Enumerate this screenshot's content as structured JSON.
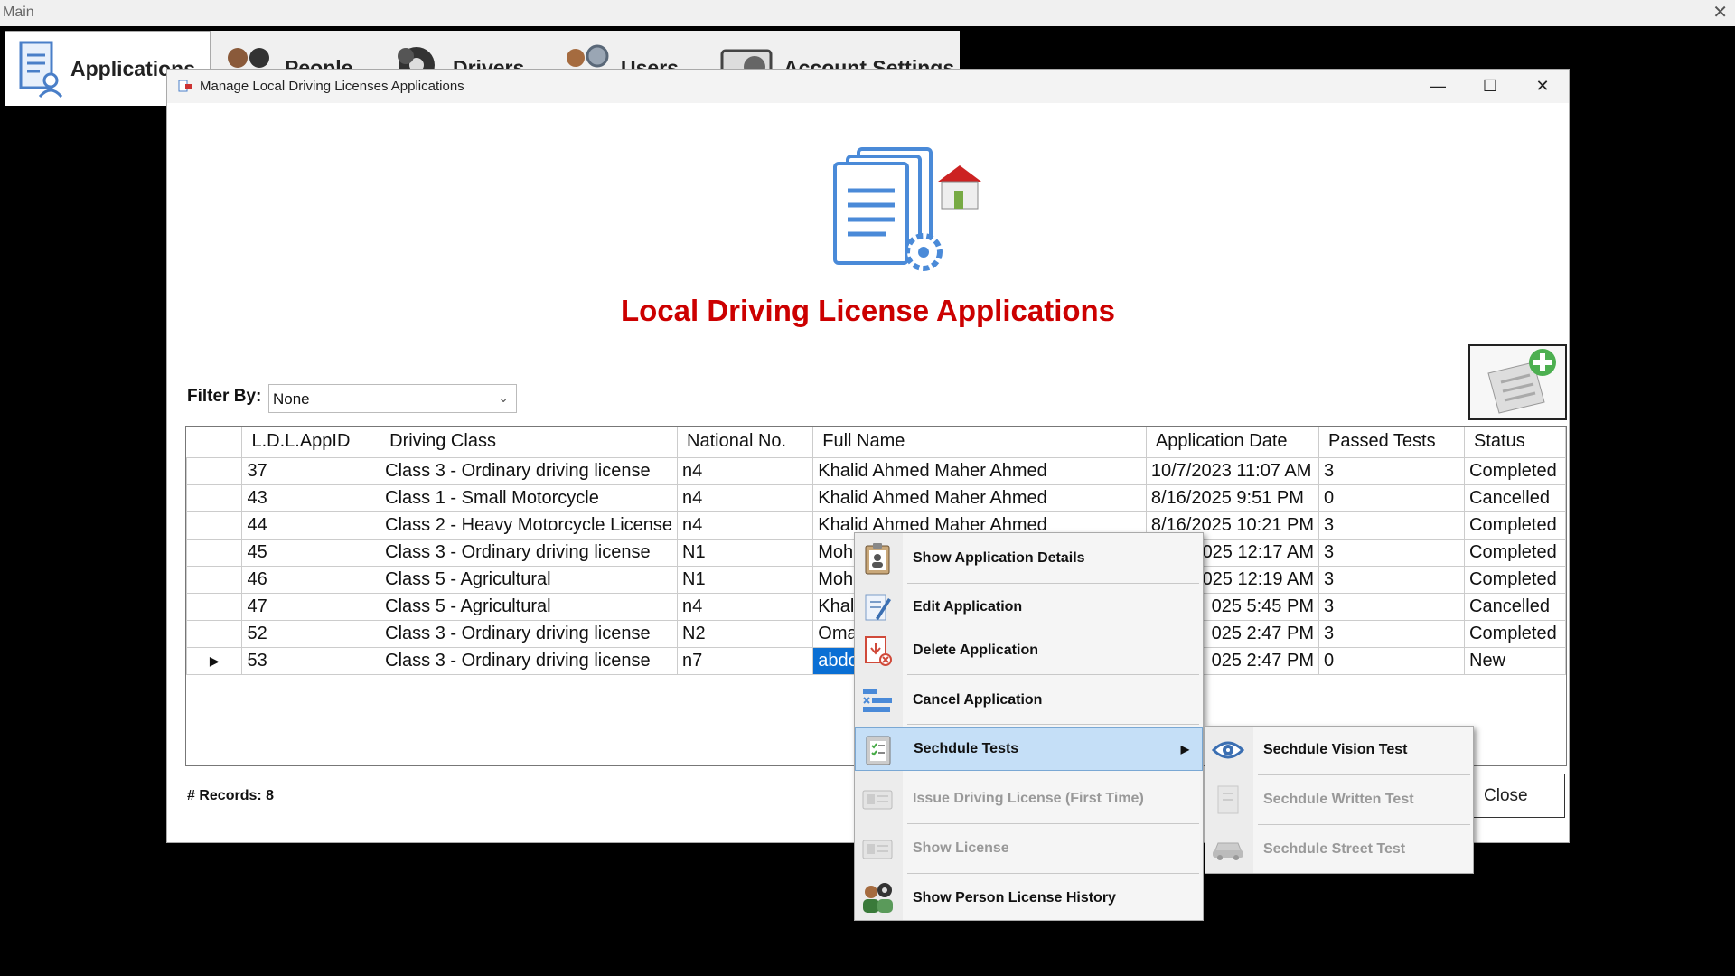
{
  "main_window": {
    "title": "Main"
  },
  "main_tabs": [
    {
      "label": "Applications",
      "icon": "applications-icon"
    },
    {
      "label": "People",
      "icon": "people-icon"
    },
    {
      "label": "Drivers",
      "icon": "drivers-icon"
    },
    {
      "label": "Users",
      "icon": "users-icon"
    },
    {
      "label": "Account Settings",
      "icon": "account-settings-icon"
    }
  ],
  "dialog": {
    "title": "Manage Local Driving Licenses Applications",
    "heading": "Local Driving License Applications",
    "filter_label": "Filter By:",
    "filter_value": "None",
    "records_label": "# Records:",
    "records_count": "8",
    "close_label": "Close"
  },
  "grid": {
    "columns": [
      "L.D.L.AppID",
      "Driving Class",
      "National No.",
      "Full Name",
      "Application Date",
      "Passed Tests",
      "Status"
    ],
    "rows": [
      [
        "37",
        "Class 3 - Ordinary driving license",
        "n4",
        "Khalid Ahmed Maher Ahmed",
        "10/7/2023 11:07 AM",
        "3",
        "Completed"
      ],
      [
        "43",
        "Class 1 - Small Motorcycle",
        "n4",
        "Khalid Ahmed Maher Ahmed",
        "8/16/2025 9:51 PM",
        "0",
        "Cancelled"
      ],
      [
        "44",
        "Class 2 - Heavy Motorcycle License",
        "n4",
        "Khalid Ahmed Maher Ahmed",
        "8/16/2025 10:21 PM",
        "3",
        "Completed"
      ],
      [
        "45",
        "Class 3 - Ordinary driving license",
        "N1",
        "Moha",
        "025 12:17 AM",
        "3",
        "Completed"
      ],
      [
        "46",
        "Class 5 - Agricultural",
        "N1",
        "Moha",
        "025 12:19 AM",
        "3",
        "Completed"
      ],
      [
        "47",
        "Class 5 - Agricultural",
        "n4",
        "Khali",
        "025 5:45 PM",
        "3",
        "Cancelled"
      ],
      [
        "52",
        "Class 3 - Ordinary driving license",
        "N2",
        "Omar",
        "025 2:47 PM",
        "3",
        "Completed"
      ],
      [
        "53",
        "Class 3 - Ordinary driving license",
        "n7",
        "abdo",
        "025 2:47 PM",
        "0",
        "New"
      ]
    ],
    "selected_row_marker": "▶"
  },
  "context_menu": [
    {
      "label": "Show Application Details",
      "icon": "clipboard-person-icon",
      "enabled": true
    },
    {
      "label": "Edit Application",
      "icon": "edit-document-icon",
      "enabled": true
    },
    {
      "label": "Delete Application",
      "icon": "delete-document-icon",
      "enabled": true
    },
    {
      "label": "Cancel Application",
      "icon": "cancel-list-icon",
      "enabled": true
    },
    {
      "label": "Sechdule Tests",
      "icon": "schedule-tests-icon",
      "enabled": true,
      "highlighted": true
    },
    {
      "label": "Issue Driving License (First Time)",
      "icon": "issue-license-icon",
      "enabled": false
    },
    {
      "label": "Show License",
      "icon": "license-icon",
      "enabled": false
    },
    {
      "label": "Show Person License History",
      "icon": "person-history-icon",
      "enabled": true
    }
  ],
  "submenu": [
    {
      "label": "Sechdule Vision Test",
      "icon": "eye-icon",
      "enabled": true
    },
    {
      "label": "Sechdule Written Test",
      "icon": "written-test-icon",
      "enabled": false
    },
    {
      "label": "Sechdule Street Test",
      "icon": "car-icon",
      "enabled": false
    }
  ],
  "colors": {
    "heading": "#cc0000",
    "selection": "#0a6fd4",
    "menu_highlight": "#c5dff7"
  }
}
